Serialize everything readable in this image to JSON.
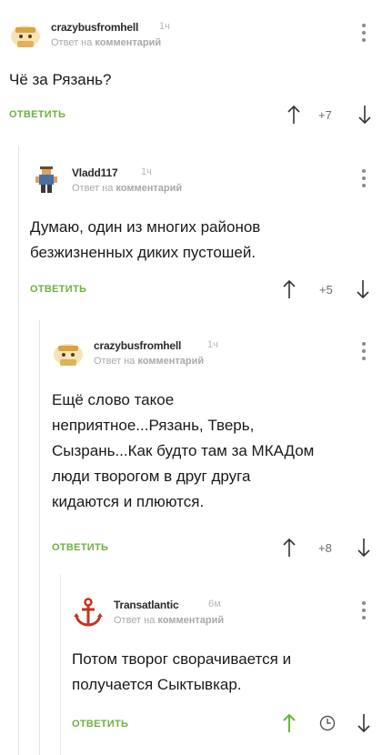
{
  "reply_to_prefix": "Ответ на",
  "reply_to_word": "комментарий",
  "reply_label": "ОТВЕТИТЬ",
  "colors": {
    "accent": "#6cb33e",
    "thread_line": "#e4e4e4"
  },
  "comments": [
    {
      "username": "crazybusfromhell",
      "time": "1ч",
      "reply_to": "Ответ на комментарий",
      "lines": [
        "Чё за Рязань?"
      ],
      "rating": "+7",
      "avatar_icon": "cat-eating-icon"
    },
    {
      "username": "Vladd117",
      "time": "1ч",
      "reply_to": "Ответ на комментарий",
      "lines": [
        "Думаю, один из многих районов",
        "безжизненных диких пустошей."
      ],
      "rating": "+5",
      "avatar_icon": "pixel-man-icon"
    },
    {
      "username": "crazybusfromhell",
      "time": "1ч",
      "reply_to": "Ответ на комментарий",
      "lines": [
        "Ещё слово такое",
        "неприятное...Рязань, Тверь,",
        "Сызрань...Как будто там за МКАДом",
        "люди творогом в друг друга",
        "кидаются и плюются."
      ],
      "rating": "+8",
      "avatar_icon": "cat-eating-icon"
    },
    {
      "username": "Transatlantic",
      "time": "6м",
      "reply_to": "Ответ на комментарий",
      "lines": [
        "Потом творог сворачивается и",
        "получается Сыктывкар."
      ],
      "rating": "",
      "avatar_icon": "anchor-icon",
      "status_icon": "clock-icon"
    }
  ]
}
